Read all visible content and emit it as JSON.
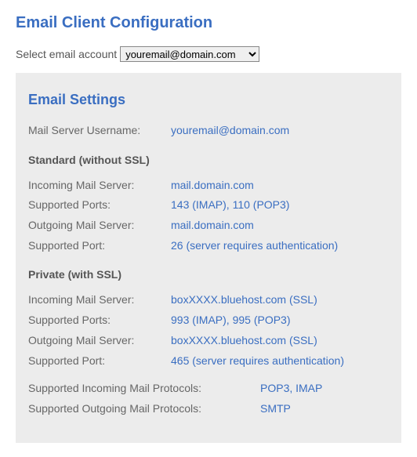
{
  "page_title": "Email Client Configuration",
  "account": {
    "label": "Select email account",
    "selected": "youremail@domain.com"
  },
  "settings": {
    "title": "Email Settings",
    "username_label": "Mail Server Username:",
    "username_value": "youremail@domain.com",
    "standard_header": "Standard (without SSL)",
    "standard": {
      "incoming_label": "Incoming Mail Server:",
      "incoming_value": "mail.domain.com",
      "ports_label": "Supported Ports:",
      "ports_value": "143 (IMAP), 110 (POP3)",
      "outgoing_label": "Outgoing Mail Server:",
      "outgoing_value": "mail.domain.com",
      "port_label": "Supported Port:",
      "port_value": "26 (server requires authentication)"
    },
    "private_header": "Private (with SSL)",
    "private": {
      "incoming_label": "Incoming Mail Server:",
      "incoming_value": "boxXXXX.bluehost.com (SSL)",
      "ports_label": "Supported Ports:",
      "ports_value": "993 (IMAP), 995 (POP3)",
      "outgoing_label": "Outgoing Mail Server:",
      "outgoing_value": "boxXXXX.bluehost.com (SSL)",
      "port_label": "Supported Port:",
      "port_value": "465 (server requires authentication)"
    },
    "protocols": {
      "incoming_label": "Supported Incoming Mail Protocols:",
      "incoming_value": "POP3, IMAP",
      "outgoing_label": "Supported Outgoing Mail Protocols:",
      "outgoing_value": "SMTP"
    }
  }
}
